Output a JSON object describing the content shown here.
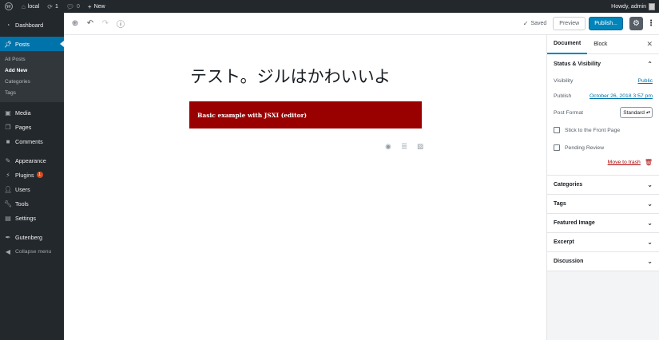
{
  "adminbar": {
    "site_name": "local",
    "updates_count": "1",
    "comments_count": "0",
    "new_label": "New",
    "greeting": "Howdy, admin"
  },
  "sidebar": {
    "dashboard": "Dashboard",
    "posts": "Posts",
    "posts_sub": [
      "All Posts",
      "Add New",
      "Categories",
      "Tags"
    ],
    "media": "Media",
    "pages": "Pages",
    "comments": "Comments",
    "appearance": "Appearance",
    "plugins": "Plugins",
    "plugins_badge": "1",
    "users": "Users",
    "tools": "Tools",
    "settings": "Settings",
    "gutenberg": "Gutenberg",
    "collapse": "Collapse menu"
  },
  "toolbar": {
    "saved_label": "Saved",
    "preview_label": "Preview",
    "publish_label": "Publish..."
  },
  "editor": {
    "title": "テスト。ジルはかわいいよ",
    "block_text": "Basic example with JSXI (editor)"
  },
  "panel": {
    "tabs": [
      "Document",
      "Block"
    ],
    "status_title": "Status & Visibility",
    "visibility_label": "Visibility",
    "visibility_value": "Public",
    "publish_label": "Publish",
    "publish_value": "October 26, 2018 3:57 pm",
    "format_label": "Post Format",
    "format_value": "Standard",
    "stick_label": "Stick to the Front Page",
    "pending_label": "Pending Review",
    "trash_label": "Move to trash",
    "sections": [
      "Categories",
      "Tags",
      "Featured Image",
      "Excerpt",
      "Discussion"
    ]
  }
}
